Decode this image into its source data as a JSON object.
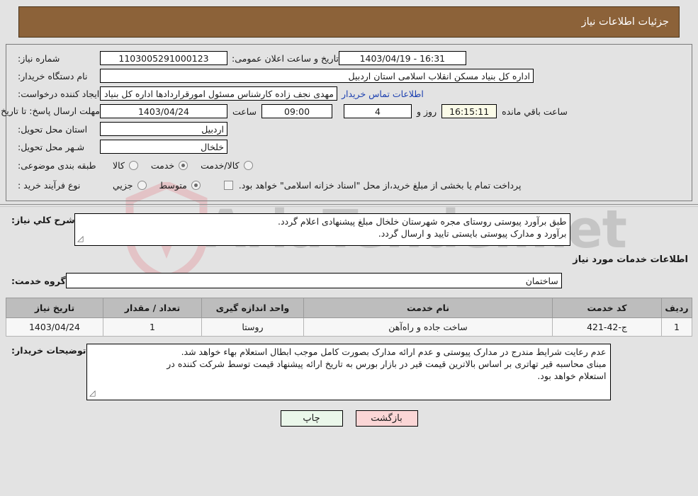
{
  "header": {
    "title": "جزئیات اطلاعات نیاز"
  },
  "watermark": {
    "text": "AriaTender.net",
    "shield_color": "#e8c9cc",
    "text_color": "#8a8a8a"
  },
  "form": {
    "need_number_label": "شماره نیاز:",
    "need_number_value": "1103005291000123",
    "announce_datetime_label": "تاریخ و ساعت اعلان عمومی:",
    "announce_datetime_value": "16:31 - 1403/04/19",
    "buyer_org_label": "نام دستگاه خریدار:",
    "buyer_org_value": "اداره کل بنیاد مسکن انقلاب اسلامی استان اردبیل",
    "requester_label": "ایجاد کننده درخواست:",
    "requester_value": "مهدی نجف زاده کارشناس مسئول امورقراردادها اداره کل بنیاد مسکن انقلاب اسـ",
    "buyer_contact_link": "اطلاعات تماس خریدار",
    "deadline_label": "مهلت ارسال پاسخ: تا تاریخ:",
    "deadline_date": "1403/04/24",
    "deadline_time_label": "ساعت",
    "deadline_time": "09:00",
    "days_value": "4",
    "days_label": "روز و",
    "remaining_time": "16:15:11",
    "remaining_label": "ساعت باقي مانده",
    "province_label": "استان محل تحویل:",
    "province_value": "اردبیل",
    "city_label": "شـهر محل تحویل:",
    "city_value": "خلخال",
    "classification_label": "طبقه بندی موضوعی:",
    "classification_options": [
      {
        "label": "کالا",
        "checked": false
      },
      {
        "label": "خدمت",
        "checked": true
      },
      {
        "label": "کالا/خدمت",
        "checked": false
      }
    ],
    "process_label": "نوع فرآیند خرید :",
    "process_options": [
      {
        "label": "جزیي",
        "checked": false
      },
      {
        "label": "متوسط",
        "checked": true
      }
    ],
    "treasury_checkbox_checked": false,
    "treasury_note": "پرداخت تمام یا بخشی از مبلغ خرید،از محل \"اسناد خزانه اسلامی\" خواهد بود."
  },
  "description": {
    "label": "شرح کلي نیاز:",
    "lines": [
      "طبق برآورد پیوستی روستای مجره شهرستان خلخال مبلغ پیشنهادی اعلام گردد.",
      "برآورد و مدارک پیوستی بایستی تایید و ارسال گردد."
    ]
  },
  "services_section": {
    "title": "اطلاعات خدمات مورد نیاز",
    "group_label": "گروه خدمت:",
    "group_value": "ساختمان"
  },
  "table": {
    "columns": [
      "ردیف",
      "کد خدمت",
      "نام خدمت",
      "واحد اندازه گیری",
      "تعداد / مقدار",
      "تاریخ نیاز"
    ],
    "rows": [
      {
        "row_no": "1",
        "service_code": "ج-42-421",
        "service_name": "ساخت جاده و راه‌آهن",
        "unit": "روستا",
        "quantity": "1",
        "need_date": "1403/04/24"
      }
    ]
  },
  "buyer_notes": {
    "label": "توضیحات خریدار:",
    "lines": [
      "عدم رعایت شرایط مندرج در مدارک پیوستی و عدم ارائه مدارک بصورت کامل موجب ابطال استعلام بهاء خواهد شد.",
      "مبنای محاسبه قیر تهاتری بر اساس بالاترین قیمت قیر در بازار بورس به تاریخ ارائه پیشنهاد قیمت توسط شرکت کننده در",
      "استعلام خواهد بود."
    ]
  },
  "footer": {
    "print_label": "چاپ",
    "back_label": "بازگشت"
  }
}
